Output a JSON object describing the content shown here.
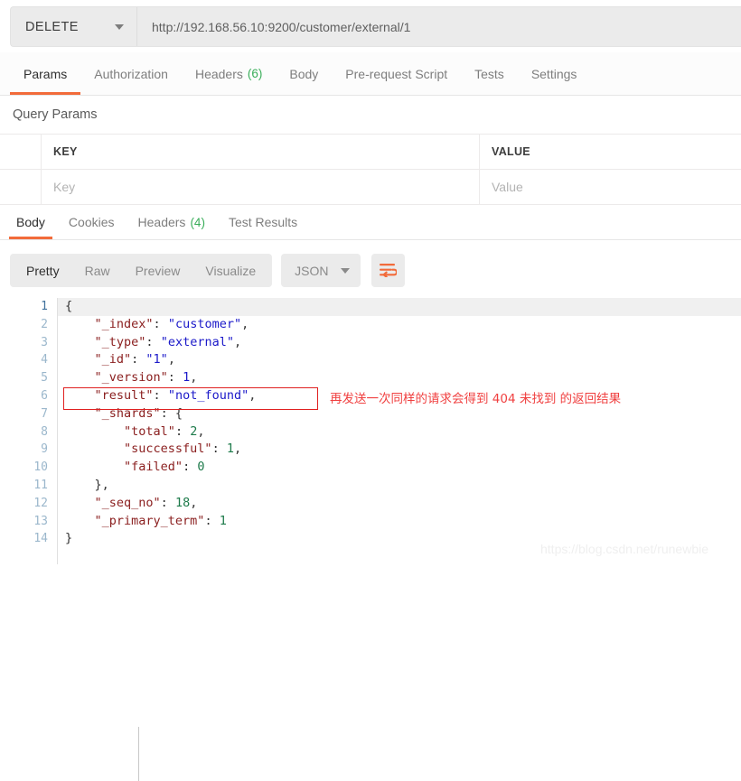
{
  "request": {
    "method": "DELETE",
    "url": "http://192.168.56.10:9200/customer/external/1",
    "tabs": [
      {
        "label": "Params",
        "count": null,
        "active": true
      },
      {
        "label": "Authorization",
        "count": null,
        "active": false
      },
      {
        "label": "Headers",
        "count": "(6)",
        "active": false
      },
      {
        "label": "Body",
        "count": null,
        "active": false
      },
      {
        "label": "Pre-request Script",
        "count": null,
        "active": false
      },
      {
        "label": "Tests",
        "count": null,
        "active": false
      },
      {
        "label": "Settings",
        "count": null,
        "active": false
      }
    ]
  },
  "query_params": {
    "section_label": "Query Params",
    "headers": {
      "key": "KEY",
      "value": "VALUE"
    },
    "row": {
      "key_placeholder": "Key",
      "value_placeholder": "Value"
    }
  },
  "response": {
    "tabs": [
      {
        "label": "Body",
        "count": null,
        "active": true
      },
      {
        "label": "Cookies",
        "count": null,
        "active": false
      },
      {
        "label": "Headers",
        "count": "(4)",
        "active": false
      },
      {
        "label": "Test Results",
        "count": null,
        "active": false
      }
    ],
    "view_modes": [
      {
        "label": "Pretty",
        "active": true
      },
      {
        "label": "Raw",
        "active": false
      },
      {
        "label": "Preview",
        "active": false
      },
      {
        "label": "Visualize",
        "active": false
      }
    ],
    "language": "JSON",
    "wrap_icon": "word-wrap-icon",
    "line_numbers": [
      "1",
      "2",
      "3",
      "4",
      "5",
      "6",
      "7",
      "8",
      "9",
      "10",
      "11",
      "12",
      "13",
      "14"
    ],
    "body_lines": [
      [
        {
          "t": "{",
          "c": "p"
        }
      ],
      [
        {
          "t": "    ",
          "c": "p"
        },
        {
          "t": "\"_index\"",
          "c": "k"
        },
        {
          "t": ": ",
          "c": "p"
        },
        {
          "t": "\"customer\"",
          "c": "s"
        },
        {
          "t": ",",
          "c": "p"
        }
      ],
      [
        {
          "t": "    ",
          "c": "p"
        },
        {
          "t": "\"_type\"",
          "c": "k"
        },
        {
          "t": ": ",
          "c": "p"
        },
        {
          "t": "\"external\"",
          "c": "s"
        },
        {
          "t": ",",
          "c": "p"
        }
      ],
      [
        {
          "t": "    ",
          "c": "p"
        },
        {
          "t": "\"_id\"",
          "c": "k"
        },
        {
          "t": ": ",
          "c": "p"
        },
        {
          "t": "\"1\"",
          "c": "s"
        },
        {
          "t": ",",
          "c": "p"
        }
      ],
      [
        {
          "t": "    ",
          "c": "p"
        },
        {
          "t": "\"_version\"",
          "c": "k"
        },
        {
          "t": ": ",
          "c": "p"
        },
        {
          "t": "1",
          "c": "n"
        },
        {
          "t": ",",
          "c": "p"
        }
      ],
      [
        {
          "t": "    ",
          "c": "p"
        },
        {
          "t": "\"result\"",
          "c": "k"
        },
        {
          "t": ": ",
          "c": "p"
        },
        {
          "t": "\"not_found\"",
          "c": "s"
        },
        {
          "t": ",",
          "c": "p"
        }
      ],
      [
        {
          "t": "    ",
          "c": "p"
        },
        {
          "t": "\"_shards\"",
          "c": "k"
        },
        {
          "t": ": {",
          "c": "p"
        }
      ],
      [
        {
          "t": "        ",
          "c": "p"
        },
        {
          "t": "\"total\"",
          "c": "k"
        },
        {
          "t": ": ",
          "c": "p"
        },
        {
          "t": "2",
          "c": "ng"
        },
        {
          "t": ",",
          "c": "p"
        }
      ],
      [
        {
          "t": "        ",
          "c": "p"
        },
        {
          "t": "\"successful\"",
          "c": "k"
        },
        {
          "t": ": ",
          "c": "p"
        },
        {
          "t": "1",
          "c": "ng"
        },
        {
          "t": ",",
          "c": "p"
        }
      ],
      [
        {
          "t": "        ",
          "c": "p"
        },
        {
          "t": "\"failed\"",
          "c": "k"
        },
        {
          "t": ": ",
          "c": "p"
        },
        {
          "t": "0",
          "c": "ng"
        }
      ],
      [
        {
          "t": "    },",
          "c": "p"
        }
      ],
      [
        {
          "t": "    ",
          "c": "p"
        },
        {
          "t": "\"_seq_no\"",
          "c": "k"
        },
        {
          "t": ": ",
          "c": "p"
        },
        {
          "t": "18",
          "c": "ng"
        },
        {
          "t": ",",
          "c": "p"
        }
      ],
      [
        {
          "t": "    ",
          "c": "p"
        },
        {
          "t": "\"_primary_term\"",
          "c": "k"
        },
        {
          "t": ": ",
          "c": "p"
        },
        {
          "t": "1",
          "c": "ng"
        }
      ],
      [
        {
          "t": "}",
          "c": "p"
        }
      ]
    ],
    "body_text": "{\n    \"_index\": \"customer\",\n    \"_type\": \"external\",\n    \"_id\": \"1\",\n    \"_version\": 1,\n    \"result\": \"not_found\",\n    \"_shards\": {\n        \"total\": 2,\n        \"successful\": 1,\n        \"failed\": 0\n    },\n    \"_seq_no\": 18,\n    \"_primary_term\": 1\n}"
  },
  "annotation": {
    "text": "再发送一次同样的请求会得到 404 未找到 的返回结果",
    "highlight_line": "6",
    "color": "#f04040"
  },
  "watermark": "https://blog.csdn.net/runewbie",
  "colors": {
    "accent": "#f26b3a",
    "count_green": "#3aae5a",
    "annotation_red": "#e02020",
    "json_key": "#8b2020",
    "json_string": "#1b19c9",
    "json_number": "#1d7a4a"
  }
}
